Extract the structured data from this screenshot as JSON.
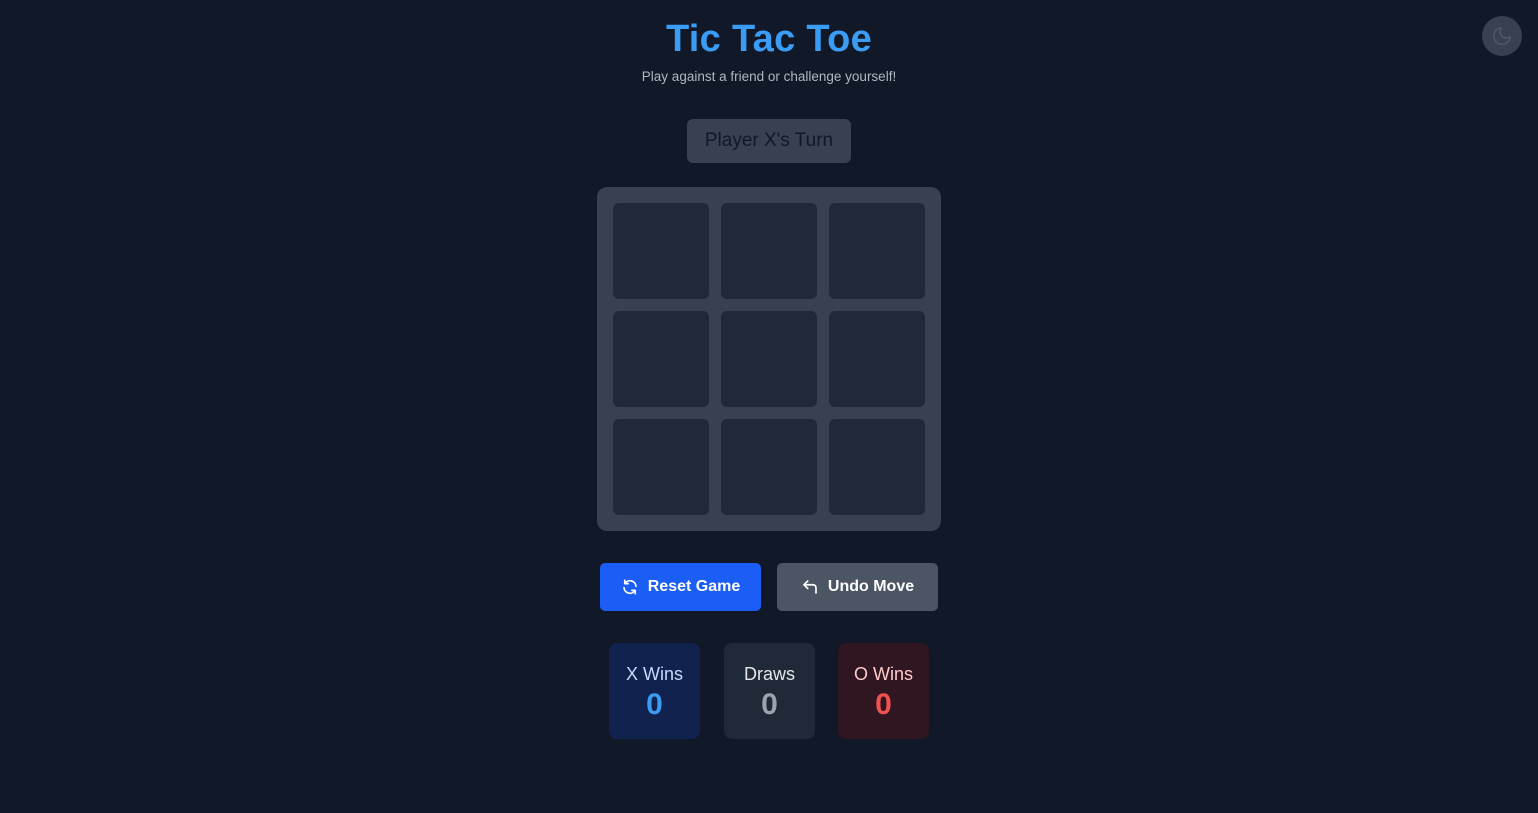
{
  "header": {
    "title": "Tic Tac Toe",
    "subtitle": "Play against a friend or challenge yourself!"
  },
  "theme_toggle": {
    "icon": "moon-icon"
  },
  "status": {
    "text": "Player X's Turn"
  },
  "board": {
    "cells": [
      "",
      "",
      "",
      "",
      "",
      "",
      "",
      "",
      ""
    ]
  },
  "controls": {
    "reset_label": "Reset Game",
    "reset_icon": "refresh-icon",
    "undo_label": "Undo Move",
    "undo_icon": "undo-arrow-icon"
  },
  "scores": {
    "x": {
      "label": "X Wins",
      "value": "0"
    },
    "draws": {
      "label": "Draws",
      "value": "0"
    },
    "o": {
      "label": "O Wins",
      "value": "0"
    }
  },
  "colors": {
    "background": "#111827",
    "accent_blue": "#3b9cf6",
    "reset_button": "#1a5ef5",
    "undo_button": "#4b5563",
    "o_red": "#f05252"
  }
}
